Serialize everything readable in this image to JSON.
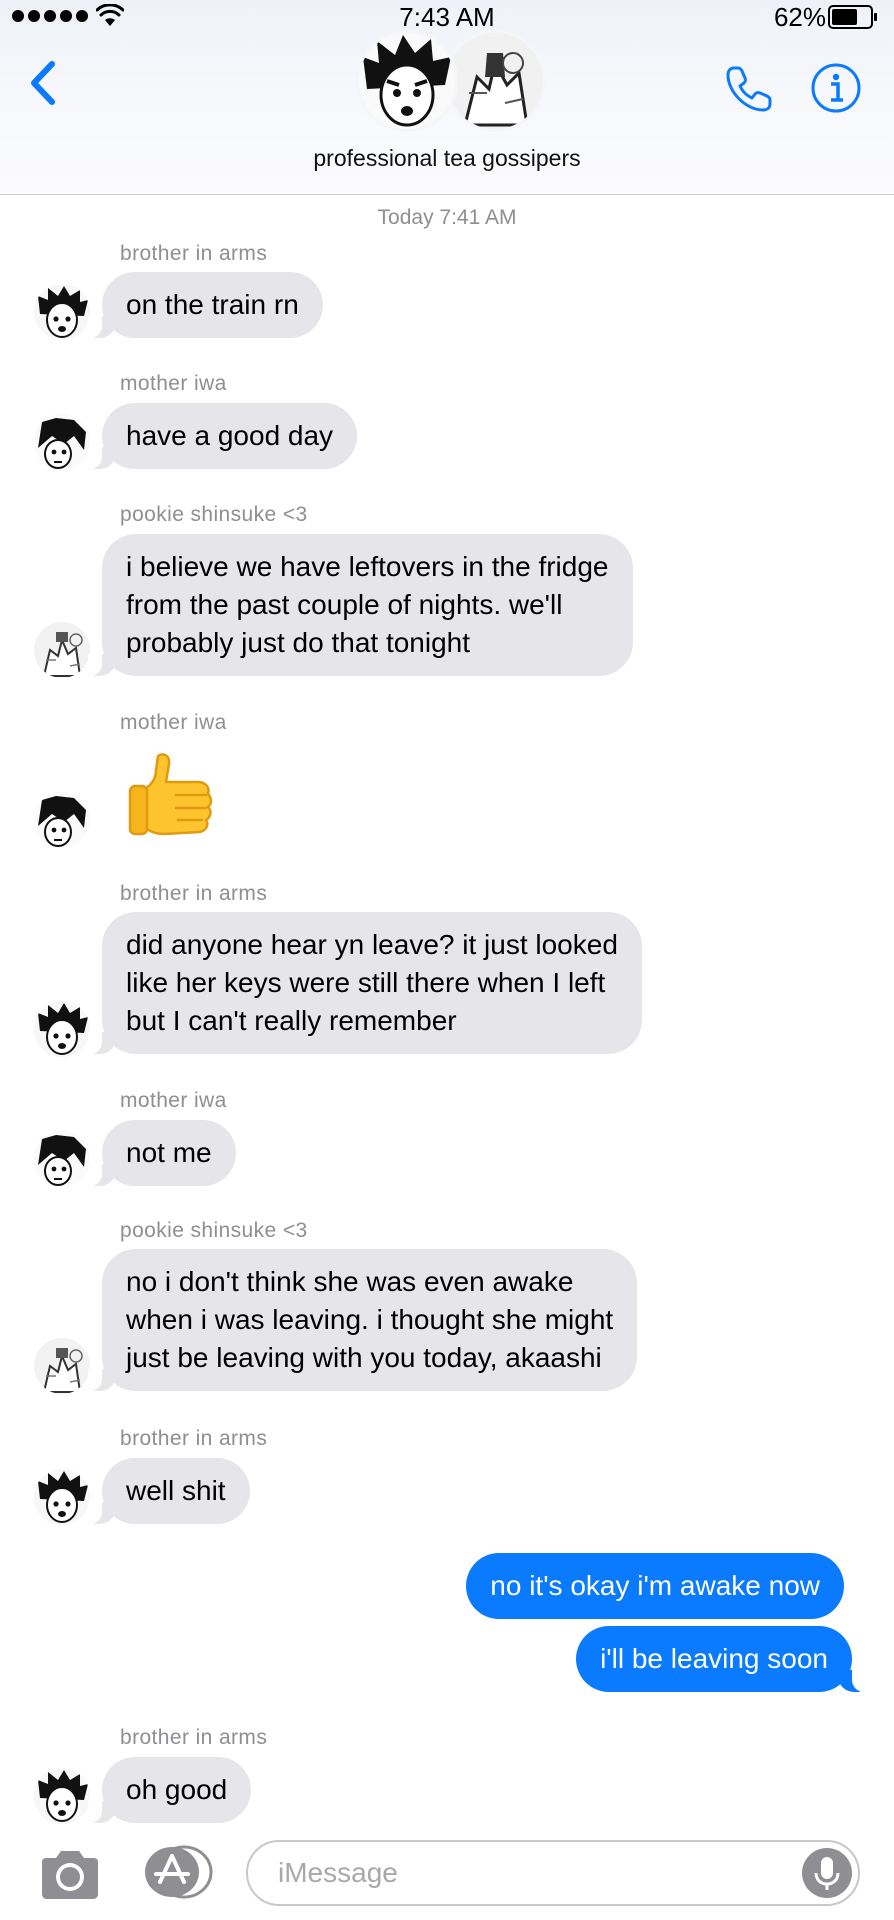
{
  "status_bar": {
    "time": "7:43 AM",
    "battery": "62%"
  },
  "header": {
    "title": "professional tea gossipers"
  },
  "conversation": {
    "timestamp": "Today 7:41 AM",
    "messages": [
      {
        "sender": "brother in arms",
        "text": "on the train rn"
      },
      {
        "sender": "mother iwa",
        "text": "have a good day"
      },
      {
        "sender": "pookie shinsuke <3",
        "text": "i believe we have leftovers in the fridge\nfrom the past couple of nights. we'll\nprobably just do that tonight"
      },
      {
        "sender": "mother iwa",
        "emoji": "thumbs-up"
      },
      {
        "sender": "brother in arms",
        "text": "did anyone hear yn leave? it just looked\nlike her keys were still there when I left\nbut I can't really remember"
      },
      {
        "sender": "mother iwa",
        "text": "not me"
      },
      {
        "sender": "pookie shinsuke <3",
        "text": "no i don't think she was even awake\nwhen i was leaving. i thought she might\njust be leaving with you today, akaashi"
      },
      {
        "sender": "brother in arms",
        "text": "well shit"
      },
      {
        "sender": "me",
        "text": "no it's okay i'm awake now"
      },
      {
        "sender": "me",
        "text": "i'll be leaving soon"
      },
      {
        "sender": "brother in arms",
        "text": "oh good"
      }
    ]
  },
  "input_bar": {
    "placeholder": "iMessage"
  },
  "colors": {
    "accent": "#0a7aff",
    "incoming_bubble": "#e5e5ea",
    "secondary_text": "#8e8e93"
  }
}
